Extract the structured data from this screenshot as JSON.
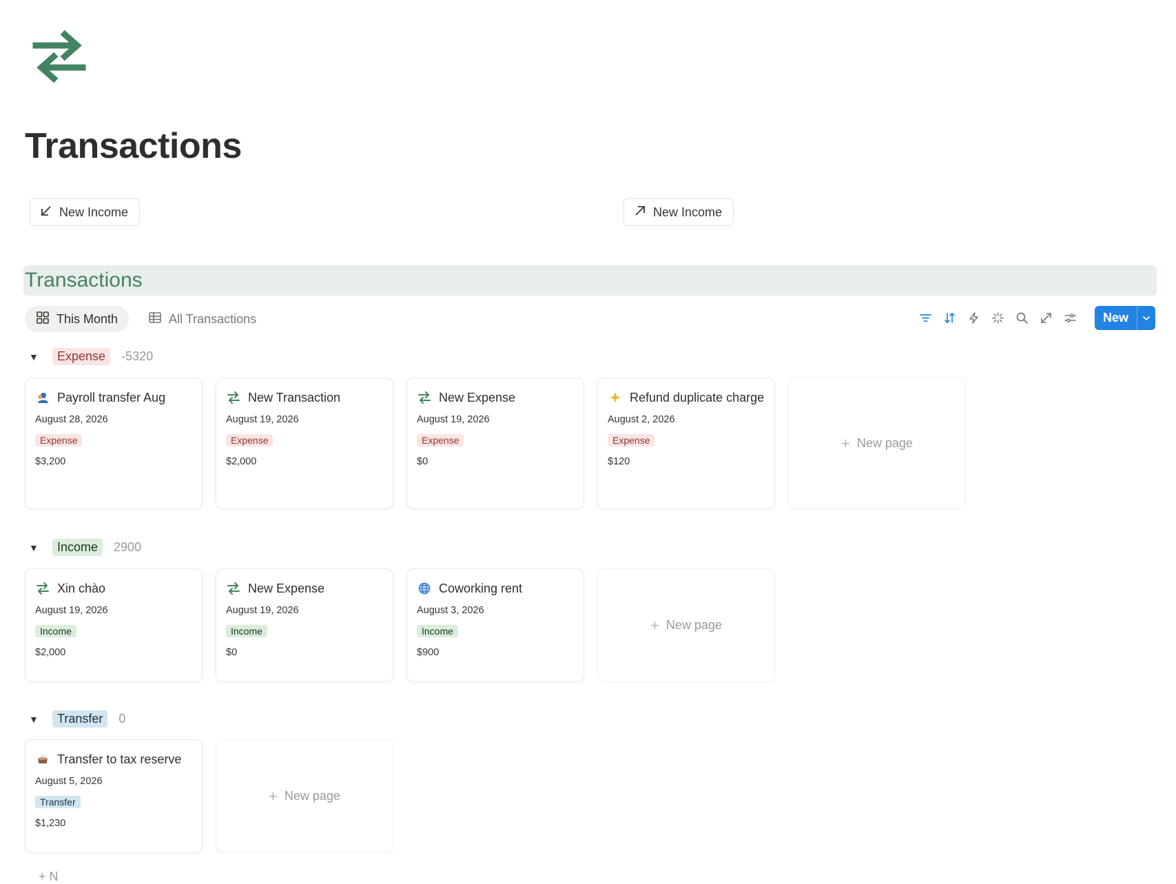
{
  "page": {
    "icon": "arrows-exchange-icon",
    "title": "Transactions"
  },
  "buttons": {
    "left": {
      "label": "New Income",
      "icon": "arrow-down-left-icon"
    },
    "right": {
      "label": "New Income",
      "icon": "arrow-up-right-icon"
    }
  },
  "database": {
    "title": "Transactions",
    "views": [
      {
        "label": "This Month",
        "icon": "board-icon",
        "active": true
      },
      {
        "label": "All Transactions",
        "icon": "table-icon",
        "active": false
      }
    ],
    "toolbar": {
      "icons": [
        "filter-icon",
        "sort-icon",
        "automation-icon",
        "ai-icon",
        "search-icon",
        "expand-icon",
        "settings-icon"
      ],
      "new_label": "New"
    }
  },
  "groups": [
    {
      "name": "Expense",
      "count": "-5320",
      "cards": [
        {
          "title": "Payroll transfer Aug",
          "icon": "person-icon",
          "date": "August 28, 2026",
          "tag": "Expense",
          "amount": "$3,200"
        },
        {
          "title": "New Transaction",
          "icon": "arrows-exchange-icon",
          "date": "August 19, 2026",
          "tag": "Expense",
          "amount": "$2,000"
        },
        {
          "title": "New Expense",
          "icon": "arrows-exchange-icon",
          "date": "August 19, 2026",
          "tag": "Expense",
          "amount": "$0"
        },
        {
          "title": "Refund duplicate charge",
          "icon": "sparkle-icon",
          "date": "August 2, 2026",
          "tag": "Expense",
          "amount": "$120"
        }
      ],
      "new_page_label": "New page"
    },
    {
      "name": "Income",
      "count": "2900",
      "cards": [
        {
          "title": "Xin chào",
          "icon": "arrows-exchange-icon",
          "date": "August 19, 2026",
          "tag": "Income",
          "amount": "$2,000"
        },
        {
          "title": "New Expense",
          "icon": "arrows-exchange-icon",
          "date": "August 19, 2026",
          "tag": "Income",
          "amount": "$0"
        },
        {
          "title": "Coworking rent",
          "icon": "globe-icon",
          "date": "August 3, 2026",
          "tag": "Income",
          "amount": "$900"
        }
      ],
      "new_page_label": "New page"
    },
    {
      "name": "Transfer",
      "count": "0",
      "cards": [
        {
          "title": "Transfer to tax reserve",
          "icon": "coffee-icon",
          "date": "August 5, 2026",
          "tag": "Transfer",
          "amount": "$1,230"
        }
      ],
      "new_page_label": "New page"
    }
  ],
  "bottom_new_label": "+ N",
  "colors": {
    "accent_green": "#448361",
    "primary_blue": "#2383e2",
    "expense_bg": "#fbe4e4",
    "income_bg": "#dbeddb",
    "transfer_bg": "#d3e5ef"
  }
}
